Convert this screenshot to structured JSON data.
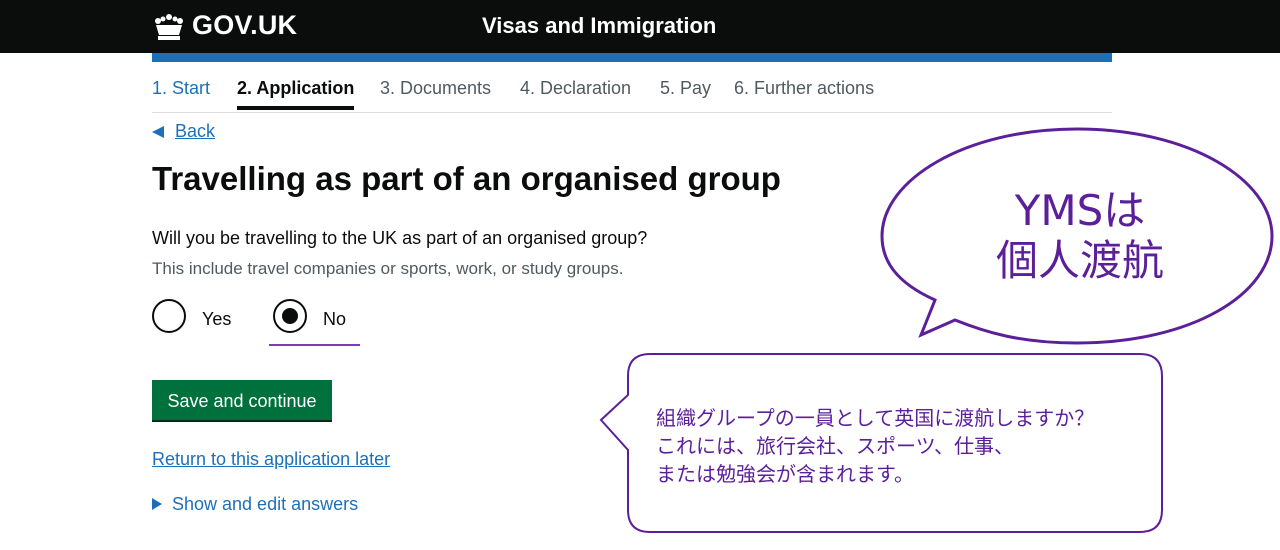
{
  "header": {
    "logo_text": "GOV.UK",
    "service_name": "Visas and Immigration"
  },
  "steps": [
    {
      "label": "1. Start",
      "state": "done"
    },
    {
      "label": "2. Application",
      "state": "active"
    },
    {
      "label": "3. Documents",
      "state": "upcoming"
    },
    {
      "label": "4. Declaration",
      "state": "upcoming"
    },
    {
      "label": "5. Pay",
      "state": "upcoming"
    },
    {
      "label": "6. Further actions",
      "state": "upcoming"
    }
  ],
  "back_link": "Back",
  "page_title": "Travelling as part of an organised group",
  "question": {
    "label": "Will you be travelling to the UK as part of an organised group?",
    "hint": "This include travel companies or sports, work, or study groups.",
    "options": [
      {
        "label": "Yes",
        "selected": false
      },
      {
        "label": "No",
        "selected": true
      }
    ]
  },
  "save_button": "Save and continue",
  "return_link": "Return to this application later",
  "details_summary": "Show and edit answers",
  "annotations": {
    "bubble_large": [
      "YMSは",
      "個人渡航"
    ],
    "bubble_small": [
      "組織グループの一員として英国に渡航しますか？",
      "これには、旅行会社、スポーツ、仕事、",
      "または勉強会が含まれます。"
    ]
  },
  "colors": {
    "header_bg": "#0b0c0c",
    "brand_blue": "#1d70b8",
    "button_green": "#00703c",
    "annotation_purple": "#5b1f9a"
  }
}
